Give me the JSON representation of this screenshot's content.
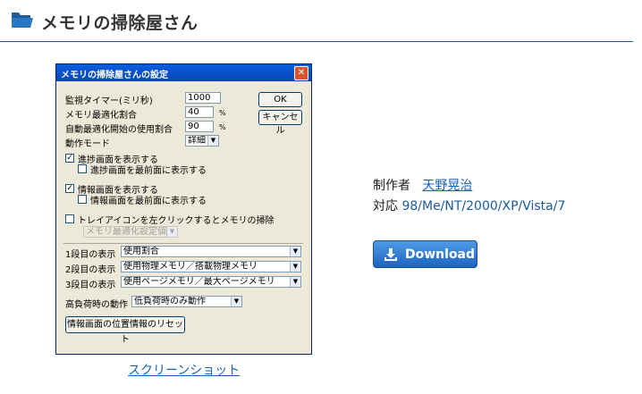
{
  "header": {
    "title": "メモリの掃除屋さん"
  },
  "screenshot": {
    "caption": "スクリーンショット",
    "dialog": {
      "title": "メモリの掃除屋さんの設定",
      "ok": "OK",
      "cancel": "キャンセル",
      "fields": {
        "timer_label": "監視タイマー(ミリ秒)",
        "timer_value": "1000",
        "optimize_label": "メモリ最適化割合",
        "optimize_value": "40",
        "auto_label": "自動最適化開始の使用割合",
        "auto_value": "90",
        "percent": "%",
        "mode_label": "動作モード",
        "mode_value": "詳細"
      },
      "progress_check": "進捗画面を表示する",
      "progress_front": "進捗画面を最前面に表示する",
      "info_check": "情報画面を表示する",
      "info_front": "情報画面を最前面に表示する",
      "tray_check": "トレイアイコンを左クリックするとメモリの掃除",
      "tray_select": "メモリ最適化設定値",
      "row1_label": "1段目の表示",
      "row1_value": "使用割合",
      "row2_label": "2段目の表示",
      "row2_value": "使用物理メモリ／搭載物理メモリ",
      "row3_label": "3段目の表示",
      "row3_value": "使用ページメモリ／最大ページメモリ",
      "load_label": "高負荷時の動作",
      "load_value": "低負荷時のみ動作",
      "reset_button": "情報画面の位置情報のリセット"
    }
  },
  "info": {
    "author_label": "制作者",
    "author_name": "天野晃治",
    "os_label": "対応",
    "os_value": "98/Me/NT/2000/XP/Vista/7"
  },
  "download": {
    "label": "Download"
  }
}
